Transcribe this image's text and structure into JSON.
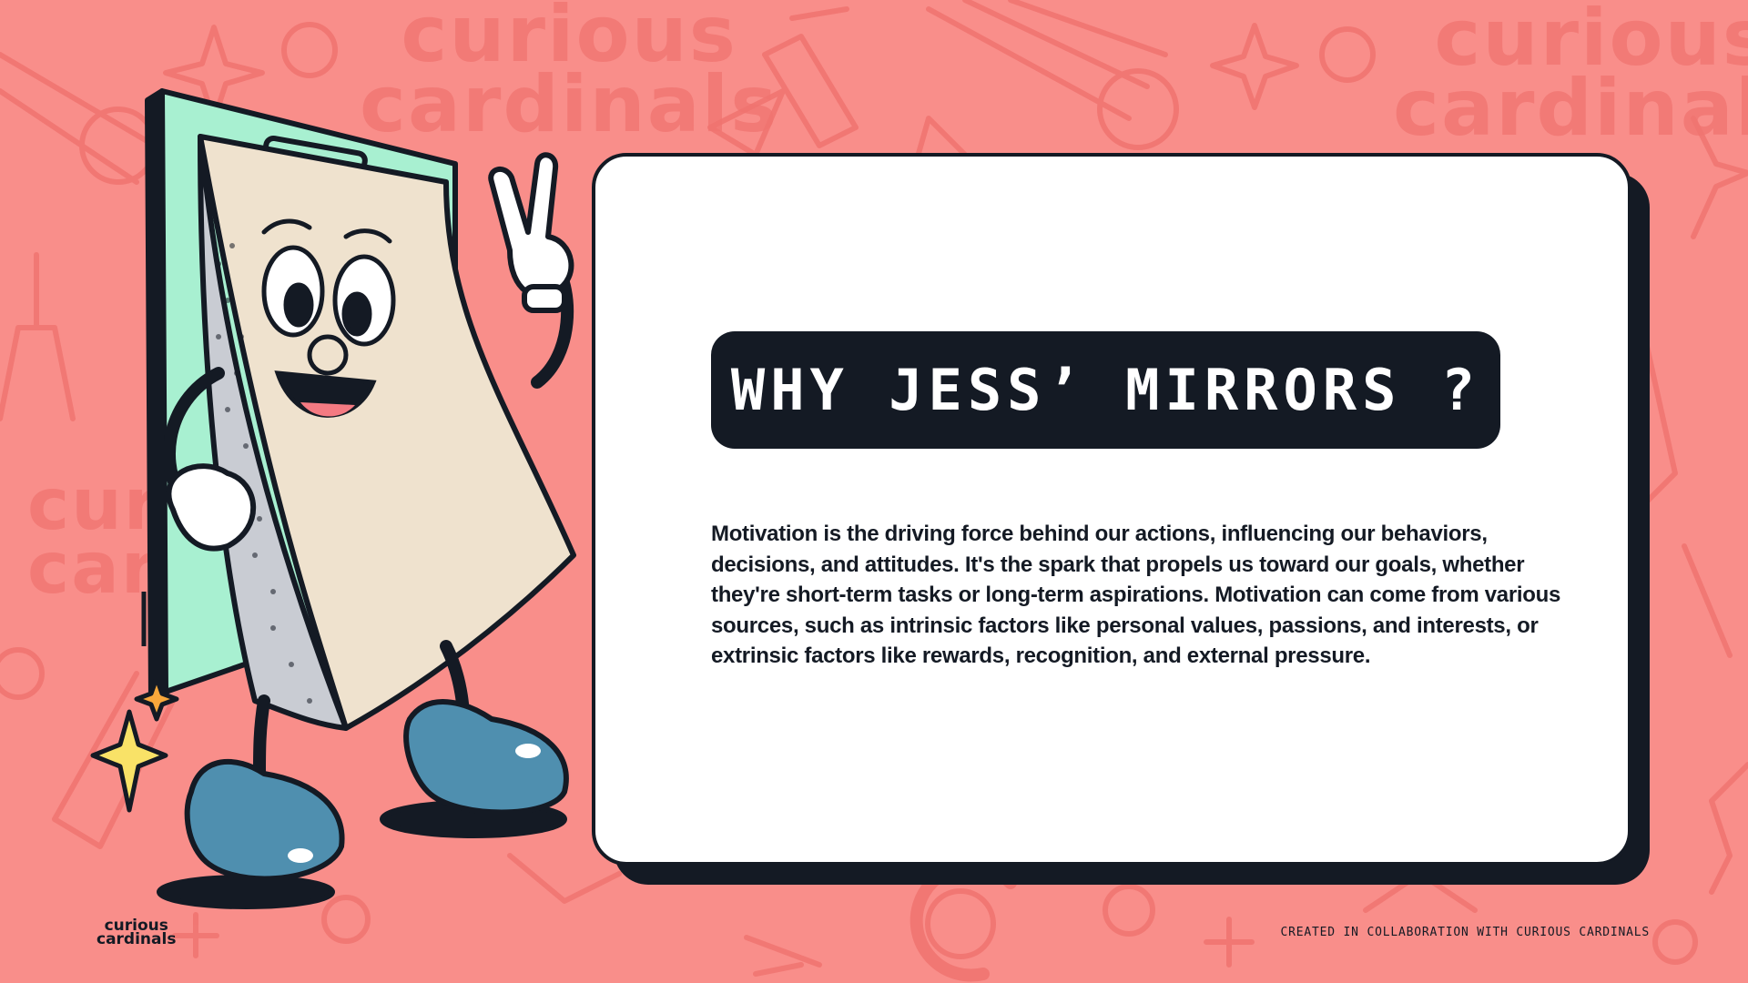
{
  "brand": {
    "watermark_line1": "curious",
    "watermark_line2": "cardinals",
    "logo_line1": "curious",
    "logo_line2": "cardinals"
  },
  "slide": {
    "title": "WHY JESS’ MIRRORS ?",
    "body": "Motivation is the driving force behind our actions, influencing our behaviors, decisions, and attitudes. It's the spark that propels us toward our goals, whether they're short-term tasks or long-term aspirations. Motivation can come from various sources, such as intrinsic factors like personal values, passions, and interests, or extrinsic factors like rewards, recognition, and external pressure."
  },
  "footer": {
    "credit": "CREATED IN COLLABORATION WITH CURIOUS CARDINALS"
  },
  "colors": {
    "background": "#F98E8A",
    "pattern": "#F07470",
    "card": "#FFFFFF",
    "dark": "#141A24",
    "clipboard": "#A8F0D1",
    "paper": "#EFE2CE",
    "shoe": "#4F8FAF",
    "star": "#F9E267"
  },
  "icons": [
    "peace-sign-hand-icon",
    "sparkle-star-icon",
    "clipboard-mascot-icon"
  ]
}
